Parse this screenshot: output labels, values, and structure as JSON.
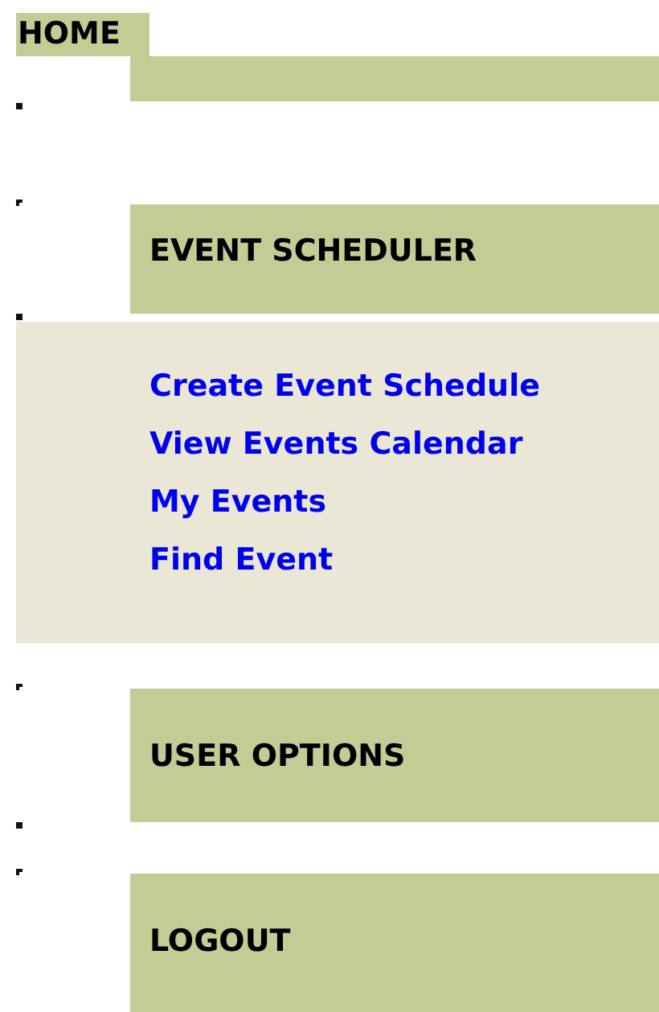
{
  "home": {
    "label": "HOME"
  },
  "sections": [
    {
      "label": "EVENT SCHEDULER",
      "links": [
        "Create Event Schedule",
        "View Events Calendar",
        "My Events",
        "Find Event"
      ]
    },
    {
      "label": "USER OPTIONS"
    },
    {
      "label": "LOGOUT"
    }
  ]
}
